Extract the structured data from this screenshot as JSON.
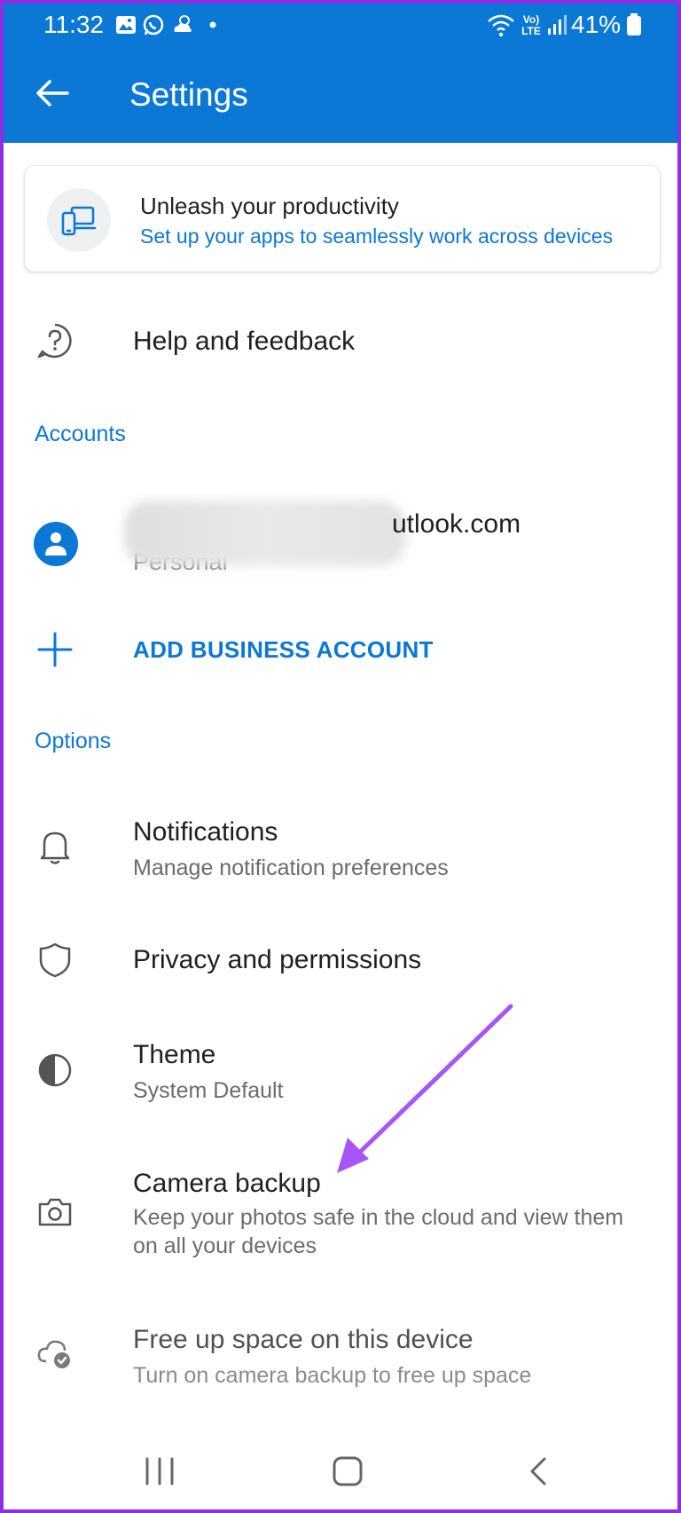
{
  "status_bar": {
    "time": "11:32",
    "battery": "41%",
    "network": "Vo) LTE"
  },
  "header": {
    "title": "Settings"
  },
  "promo": {
    "title": "Unleash your productivity",
    "subtitle": "Set up your apps to seamlessly work across devices"
  },
  "help": {
    "label": "Help and feedback"
  },
  "accounts": {
    "section_label": "Accounts",
    "account_email_visible": "utlook.com",
    "account_type": "Personal",
    "add_business_label": "ADD BUSINESS ACCOUNT"
  },
  "options": {
    "section_label": "Options",
    "items": [
      {
        "title": "Notifications",
        "subtitle": "Manage notification preferences",
        "icon": "bell-icon"
      },
      {
        "title": "Privacy and permissions",
        "subtitle": "",
        "icon": "shield-icon"
      },
      {
        "title": "Theme",
        "subtitle": "System Default",
        "icon": "half-circle-icon"
      },
      {
        "title": "Camera backup",
        "subtitle": "Keep your photos safe in the cloud and view them on all your devices",
        "icon": "camera-icon"
      },
      {
        "title": "Free up space on this device",
        "subtitle": "Turn on camera backup to free up space",
        "icon": "cloud-check-icon"
      }
    ]
  },
  "colors": {
    "accent": "#0a78d4",
    "annotation_arrow": "#a855f7",
    "frame_border": "#8e2de2"
  }
}
